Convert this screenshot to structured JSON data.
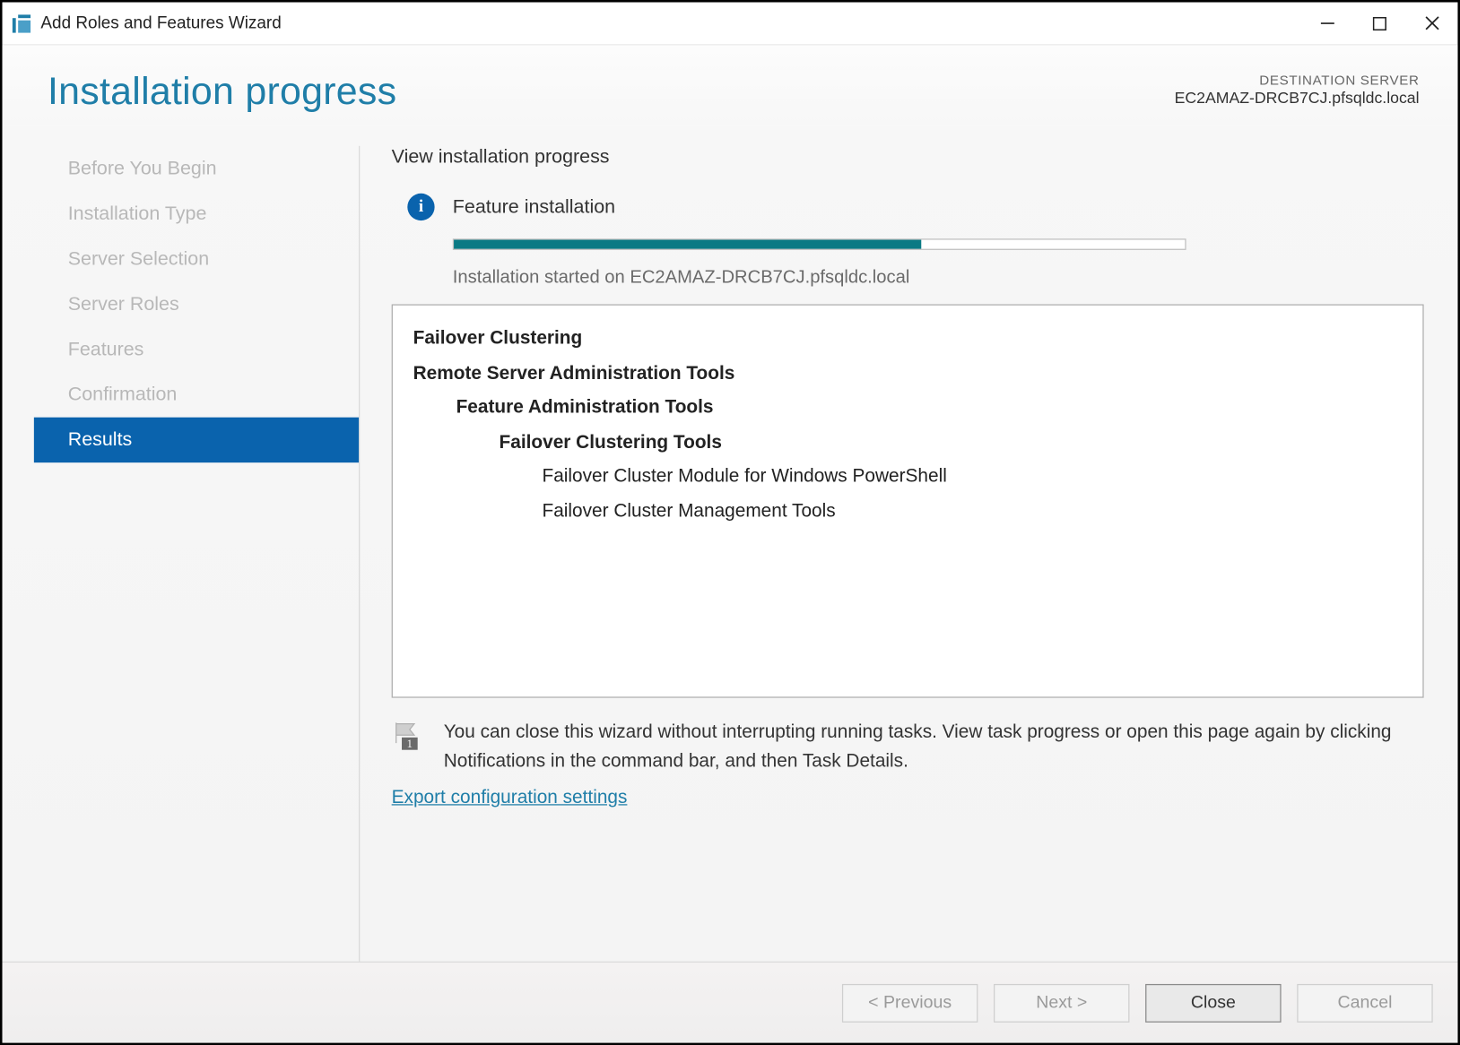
{
  "window": {
    "title": "Add Roles and Features Wizard"
  },
  "header": {
    "title": "Installation progress",
    "dest_label": "DESTINATION SERVER",
    "dest_value": "EC2AMAZ-DRCB7CJ.pfsqldc.local"
  },
  "sidebar": {
    "steps": [
      {
        "label": "Before You Begin",
        "active": false
      },
      {
        "label": "Installation Type",
        "active": false
      },
      {
        "label": "Server Selection",
        "active": false
      },
      {
        "label": "Server Roles",
        "active": false
      },
      {
        "label": "Features",
        "active": false
      },
      {
        "label": "Confirmation",
        "active": false
      },
      {
        "label": "Results",
        "active": true
      }
    ]
  },
  "main": {
    "view_label": "View installation progress",
    "feature_install_label": "Feature installation",
    "progress_percent": 64,
    "started_prefix": "Installation started on ",
    "started_host": "EC2AMAZ-DRCB7CJ.pfsqldc.local",
    "feature_tree": {
      "l0a": "Failover Clustering",
      "l0b": "Remote Server Administration Tools",
      "l1": "Feature Administration Tools",
      "l2": "Failover Clustering Tools",
      "l3a": "Failover Cluster Module for Windows PowerShell",
      "l3b": "Failover Cluster Management Tools"
    },
    "note": "You can close this wizard without interrupting running tasks. View task progress or open this page again by clicking Notifications in the command bar, and then Task Details.",
    "export_link": "Export configuration settings",
    "flag_badge": "1"
  },
  "footer": {
    "previous": "< Previous",
    "next": "Next >",
    "close": "Close",
    "cancel": "Cancel"
  }
}
